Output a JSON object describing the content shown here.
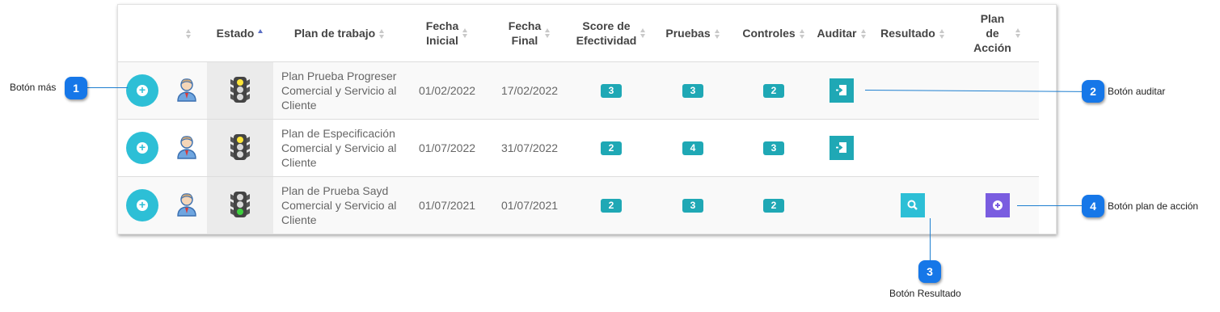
{
  "table": {
    "headers": {
      "estado": "Estado",
      "plan": "Plan de trabajo",
      "fecha_inicial": [
        "Fecha",
        "Inicial"
      ],
      "fecha_final": [
        "Fecha",
        "Final"
      ],
      "score": [
        "Score de",
        "Efectividad"
      ],
      "pruebas": "Pruebas",
      "controles": "Controles",
      "auditar": "Auditar",
      "resultado": "Resultado",
      "plan_accion": [
        "Plan",
        "de",
        "Acción"
      ]
    },
    "rows": [
      {
        "estado_light": "yellow",
        "plan": [
          "Plan Prueba Progreser",
          "Comercial y Servicio al",
          "Cliente"
        ],
        "fecha_inicial": "01/02/2022",
        "fecha_final": "17/02/2022",
        "score": "3",
        "pruebas": "3",
        "controles": "2",
        "auditar": true,
        "resultado": false,
        "plan_accion": false
      },
      {
        "estado_light": "yellow",
        "plan": [
          "Plan de Especificación",
          "Comercial y Servicio al",
          "Cliente"
        ],
        "fecha_inicial": "01/07/2022",
        "fecha_final": "31/07/2022",
        "score": "2",
        "pruebas": "4",
        "controles": "3",
        "auditar": true,
        "resultado": false,
        "plan_accion": false
      },
      {
        "estado_light": "green",
        "plan": [
          "Plan de Prueba Sayd",
          "Comercial y Servicio al",
          "Cliente"
        ],
        "fecha_inicial": "01/07/2021",
        "fecha_final": "01/07/2021",
        "score": "2",
        "pruebas": "3",
        "controles": "2",
        "auditar": false,
        "resultado": true,
        "plan_accion": true
      }
    ]
  },
  "callouts": [
    {
      "number": "1",
      "label": "Botón más"
    },
    {
      "number": "2",
      "label": "Botón auditar"
    },
    {
      "number": "3",
      "label": "Botón Resultado"
    },
    {
      "number": "4",
      "label": "Botón plan de acción"
    }
  ],
  "colors": {
    "teal": "#1fa8b5",
    "sky": "#2dbfd6",
    "purple": "#7a5de0",
    "callout": "#1677e8"
  }
}
